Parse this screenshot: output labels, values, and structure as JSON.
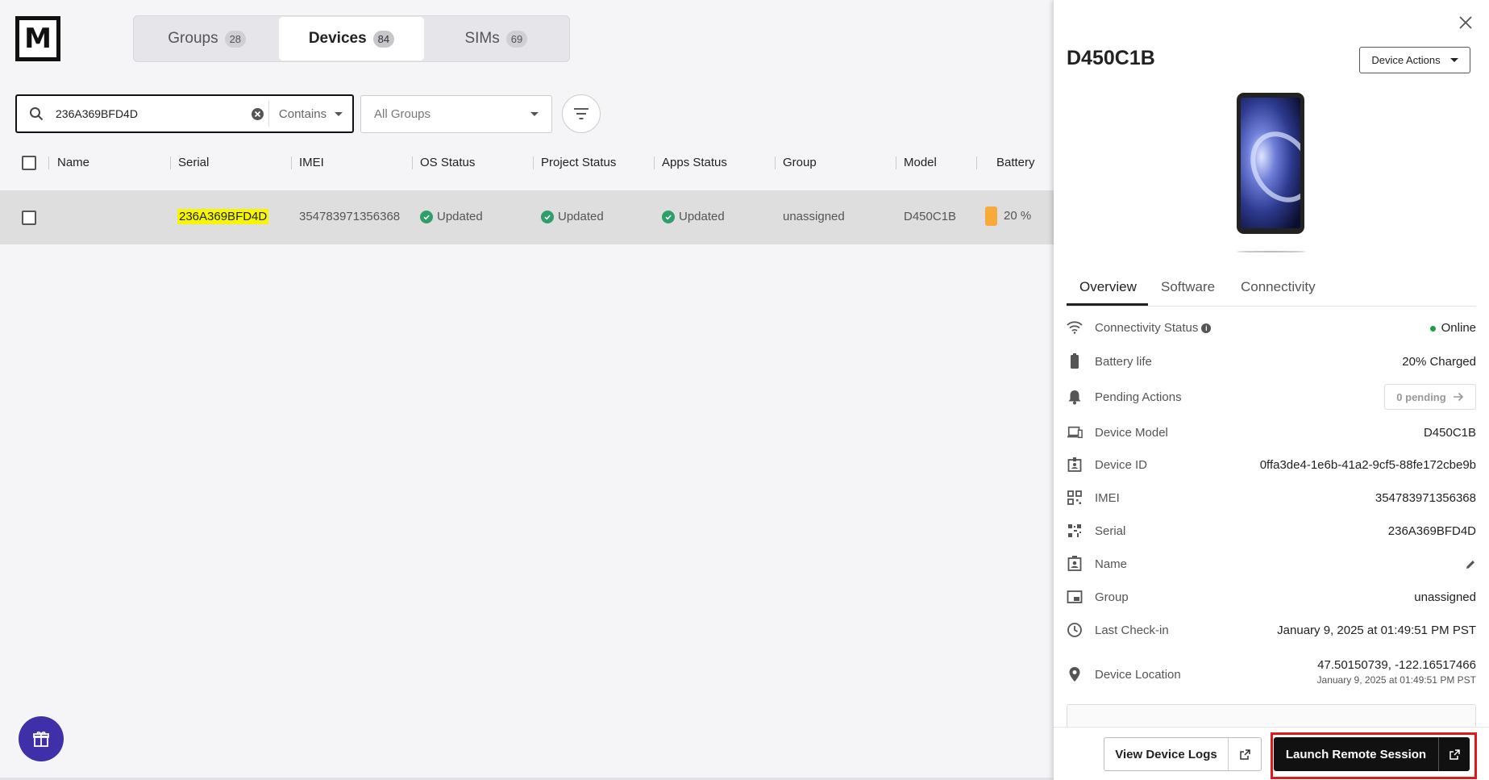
{
  "logo": {
    "letter": "M"
  },
  "nav_tabs": [
    {
      "label": "Groups",
      "count": "28"
    },
    {
      "label": "Devices",
      "count": "84"
    },
    {
      "label": "SIMs",
      "count": "69"
    }
  ],
  "search": {
    "value": "236A369BFD4D",
    "match_mode": "Contains"
  },
  "groups_filter": {
    "selected": "All Groups"
  },
  "table": {
    "columns": [
      "Name",
      "Serial",
      "IMEI",
      "OS Status",
      "Project Status",
      "Apps Status",
      "Group",
      "Model",
      "Battery"
    ],
    "rows": [
      {
        "name": "",
        "serial": "236A369BFD4D",
        "imei": "354783971356368",
        "os_status": "Updated",
        "project_status": "Updated",
        "apps_status": "Updated",
        "group": "unassigned",
        "model": "D450C1B",
        "battery": "20 %"
      }
    ]
  },
  "drawer": {
    "title": "D450C1B",
    "actions_label": "Device Actions",
    "tabs": [
      "Overview",
      "Software",
      "Connectivity"
    ],
    "fields": {
      "connectivity": {
        "label": "Connectivity Status",
        "value": "Online"
      },
      "battery": {
        "label": "Battery life",
        "value": "20% Charged"
      },
      "pending": {
        "label": "Pending Actions",
        "value": "0 pending"
      },
      "model": {
        "label": "Device Model",
        "value": "D450C1B"
      },
      "device_id": {
        "label": "Device ID",
        "value": "0ffa3de4-1e6b-41a2-9cf5-88fe172cbe9b"
      },
      "imei": {
        "label": "IMEI",
        "value": "354783971356368"
      },
      "serial": {
        "label": "Serial",
        "value": "236A369BFD4D"
      },
      "name": {
        "label": "Name",
        "value": ""
      },
      "group": {
        "label": "Group",
        "value": "unassigned"
      },
      "checkin": {
        "label": "Last Check-in",
        "value": "January 9, 2025 at 01:49:51 PM PST"
      },
      "location": {
        "label": "Device Location",
        "value": "47.50150739, -122.16517466",
        "sub": "January 9, 2025 at 01:49:51 PM PST"
      }
    },
    "footer": {
      "logs_label": "View Device Logs",
      "remote_label": "Launch Remote Session"
    }
  },
  "colors": {
    "accent_dark": "#111111",
    "highlight": "#f6f600",
    "status_green": "#2e9e6a",
    "online_green": "#1aa04a",
    "battery_orange": "#f7a93a",
    "gift_purple": "#3f2fa8",
    "callout_red": "#e01818"
  }
}
